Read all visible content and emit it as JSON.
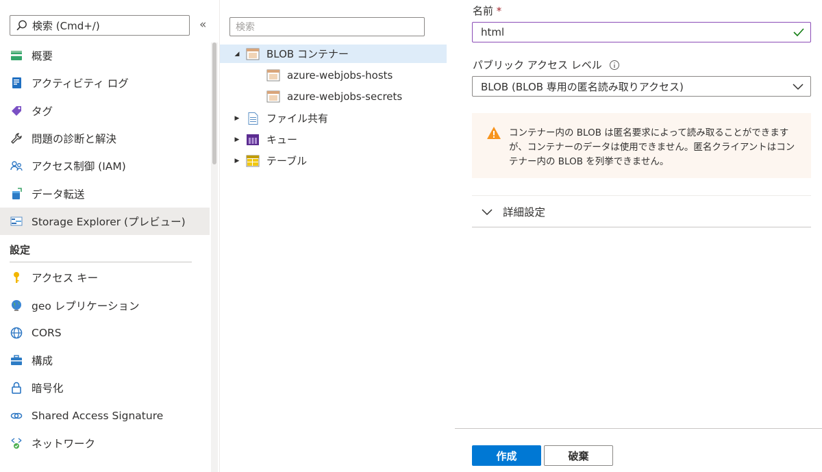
{
  "nav": {
    "search_placeholder": "検索 (Cmd+/)",
    "collapse_glyph": "«",
    "items": [
      {
        "label": "概要",
        "icon": "overview-icon"
      },
      {
        "label": "アクティビティ ログ",
        "icon": "activity-log-icon"
      },
      {
        "label": "タグ",
        "icon": "tag-icon"
      },
      {
        "label": "問題の診断と解決",
        "icon": "wrench-icon"
      },
      {
        "label": "アクセス制御 (IAM)",
        "icon": "iam-icon"
      },
      {
        "label": "データ転送",
        "icon": "data-transfer-icon"
      },
      {
        "label": "Storage Explorer (プレビュー)",
        "icon": "storage-explorer-icon",
        "selected": true
      }
    ],
    "section_settings": "設定",
    "settings_items": [
      {
        "label": "アクセス キー",
        "icon": "key-icon"
      },
      {
        "label": "geo レプリケーション",
        "icon": "globe-icon"
      },
      {
        "label": "CORS",
        "icon": "cors-icon"
      },
      {
        "label": "構成",
        "icon": "configuration-icon"
      },
      {
        "label": "暗号化",
        "icon": "lock-icon"
      },
      {
        "label": "Shared Access Signature",
        "icon": "link-icon"
      },
      {
        "label": "ネットワーク",
        "icon": "network-icon"
      }
    ]
  },
  "tree": {
    "search_placeholder": "検索",
    "nodes": [
      {
        "label": "BLOB コンテナー",
        "icon": "blob-container-icon",
        "expanded": true,
        "selected": true
      },
      {
        "label": "azure-webjobs-hosts",
        "icon": "container-icon",
        "child": true
      },
      {
        "label": "azure-webjobs-secrets",
        "icon": "container-icon",
        "child": true
      },
      {
        "label": "ファイル共有",
        "icon": "file-share-icon"
      },
      {
        "label": "キュー",
        "icon": "queue-icon"
      },
      {
        "label": "テーブル",
        "icon": "table-icon"
      }
    ]
  },
  "panel": {
    "name_label": "名前",
    "required_mark": "*",
    "name_value": "html",
    "access_label": "パブリック アクセス レベル",
    "access_value": "BLOB (BLOB 専用の匿名読み取りアクセス)",
    "warning_text": "コンテナー内の BLOB は匿名要求によって読み取ることができますが、コンテナーのデータは使用できません。匿名クライアントはコンテナー内の BLOB を列挙できません。",
    "advanced_label": "詳細設定",
    "create_button": "作成",
    "discard_button": "破棄"
  },
  "colors": {
    "primary": "#0078d4",
    "input_focus": "#8a4bb6",
    "valid_check": "#107c10",
    "warning_icon": "#d83b01",
    "warning_bg": "#fdf6f0"
  }
}
